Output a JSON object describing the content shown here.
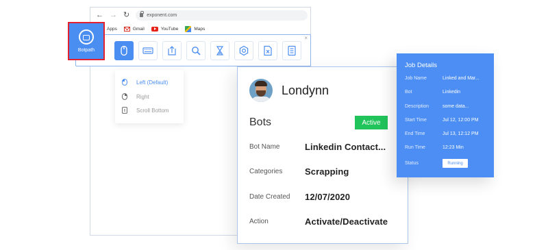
{
  "browser": {
    "url": "exponent.com",
    "bookmarks": [
      {
        "label": "Apps"
      },
      {
        "label": "Gmail"
      },
      {
        "label": "YouTube"
      },
      {
        "label": "Maps"
      }
    ]
  },
  "botpath": {
    "label": "Botpath"
  },
  "mouse_menu": {
    "items": [
      {
        "label": "Left (Default)",
        "selected": true
      },
      {
        "label": "Right",
        "selected": false
      },
      {
        "label": "Scroll Bottom",
        "selected": false
      }
    ]
  },
  "bot_card": {
    "name": "Londynn",
    "heading": "Bots",
    "status": "Active",
    "rows": [
      {
        "label": "Bot Name",
        "value": "Linkedin Contact..."
      },
      {
        "label": "Categories",
        "value": "Scrapping"
      },
      {
        "label": "Date Created",
        "value": "12/07/2020"
      },
      {
        "label": "Action",
        "value": "Activate/Deactivate"
      }
    ]
  },
  "job_details": {
    "title": "Job Details",
    "rows": [
      {
        "label": "Job Name",
        "value": "Linked and Mar..."
      },
      {
        "label": "Bot",
        "value": "Linkedin"
      },
      {
        "label": "Description",
        "value": "some data..."
      },
      {
        "label": "Start Time",
        "value": "Jul 12, 12:00 PM"
      },
      {
        "label": "End Time",
        "value": "Jul 13, 12:12 PM"
      },
      {
        "label": "Run Time",
        "value": "12:23 Min"
      }
    ],
    "status_label": "Status",
    "status_value": "Running"
  },
  "colors": {
    "accent_blue": "#4b8ef1",
    "active_green": "#21c35b",
    "highlight_red": "#e2202f"
  }
}
